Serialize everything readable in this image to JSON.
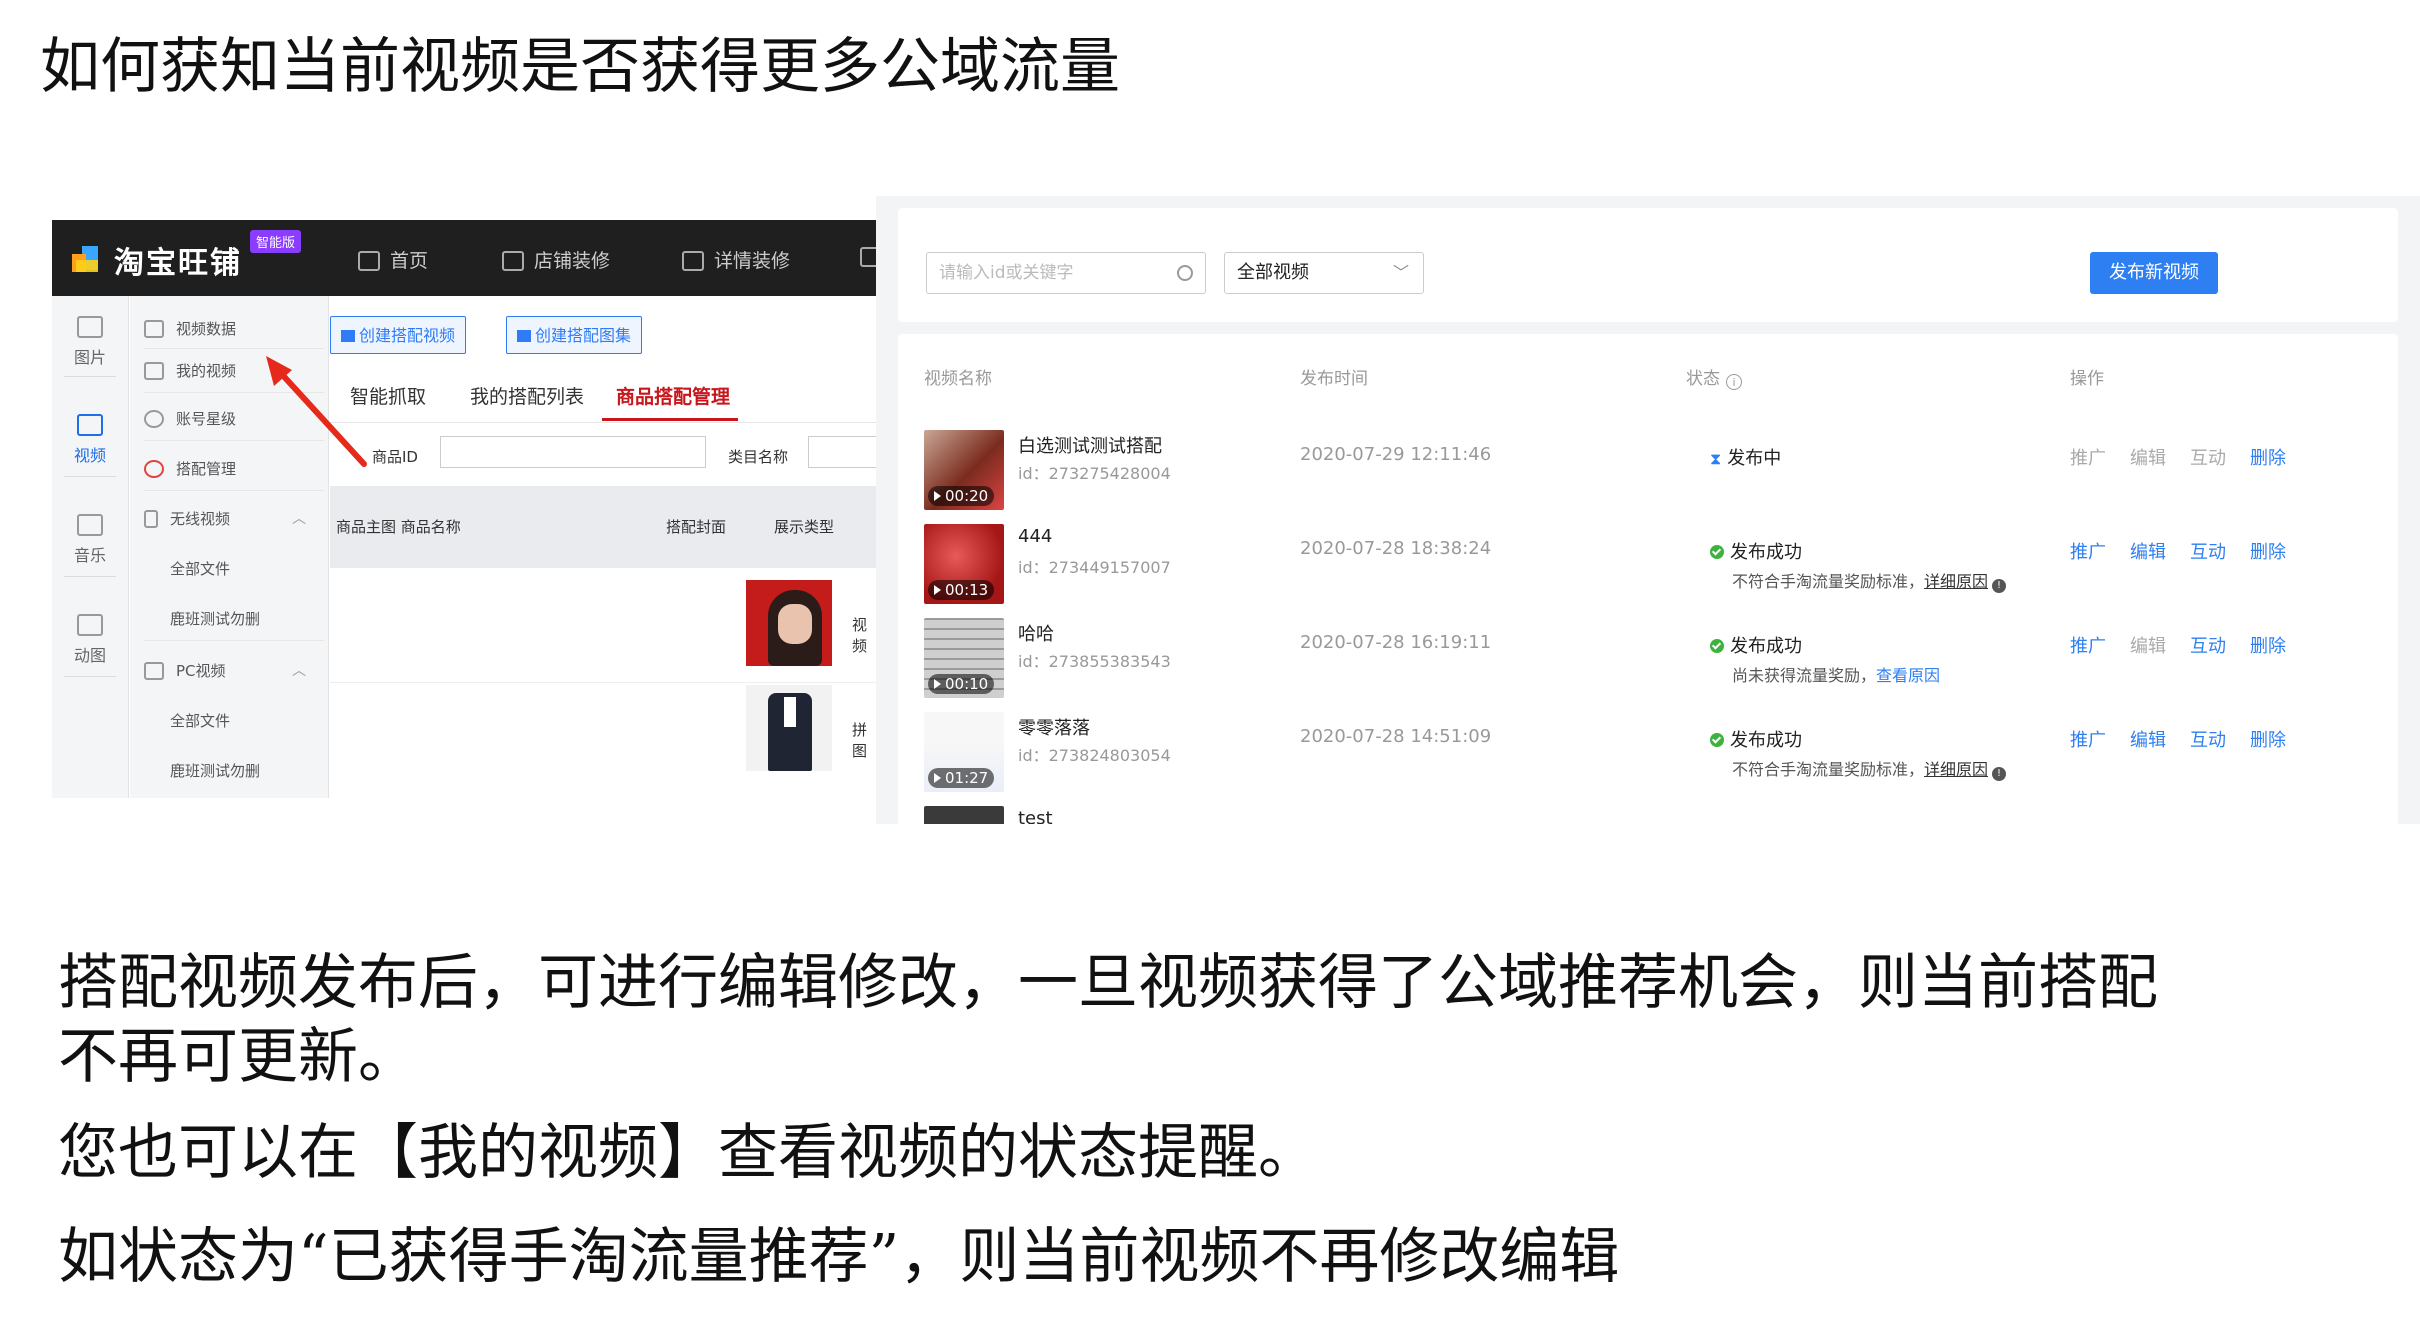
{
  "heading": "如何获知当前视频是否获得更多公域流量",
  "body_lines": [
    "搭配视频发布后，可进行编辑修改，一旦视频获得了公域推荐机会，则当前搭配",
    "不再可更新。",
    "您也可以在【我的视频】查看视频的状态提醒。",
    "如状态为“已获得手淘流量推荐”，则当前视频不再修改编辑"
  ],
  "left_panel": {
    "brand": "淘宝旺铺",
    "edition_badge": "智能版",
    "top_nav": [
      "首页",
      "店铺装修",
      "详情装修"
    ],
    "rail": [
      "图片",
      "视频",
      "音乐",
      "动图"
    ],
    "rail_active": "视频",
    "sidebar": {
      "video_data": "视频数据",
      "my_videos": "我的视频",
      "account_level": "账号星级",
      "match_manage": "搭配管理",
      "wireless_video": "无线视频",
      "wireless_all": "全部文件",
      "wireless_test": "鹿班测试勿删",
      "pc_video": "PC视频",
      "pc_all": "全部文件",
      "pc_test": "鹿班测试勿删"
    },
    "buttons": {
      "create_video": "创建搭配视频",
      "create_album": "创建搭配图集"
    },
    "tabs": [
      "智能抓取",
      "我的搭配列表",
      "商品搭配管理"
    ],
    "active_tab": "商品搭配管理",
    "filters": {
      "product_id": "商品ID",
      "category": "类目名称"
    },
    "table_headers": {
      "main_img_name": "商品主图 商品名称",
      "cover": "搭配封面",
      "type": "展示类型"
    },
    "rows": [
      {
        "type": "视频"
      },
      {
        "type": "拼图"
      }
    ]
  },
  "right_panel": {
    "search_placeholder": "请输入id或关键字",
    "filter_value": "全部视频",
    "publish_button": "发布新视频",
    "headers": {
      "name": "视频名称",
      "time": "发布时间",
      "status": "状态",
      "ops": "操作"
    },
    "ops_labels": [
      "推广",
      "编辑",
      "互动",
      "删除"
    ],
    "videos": [
      {
        "name": "白选测试测试搭配",
        "id": "id：273275428004",
        "duration": "00:20",
        "time": "2020-07-29 12:11:46",
        "status": "发布中",
        "note_text": "",
        "note_link": ""
      },
      {
        "name": "444",
        "id": "id：273449157007",
        "duration": "00:13",
        "time": "2020-07-28 18:38:24",
        "status": "发布成功",
        "note_text": "不符合手淘流量奖励标准，",
        "note_link": "详细原因"
      },
      {
        "name": "哈哈",
        "id": "id：273855383543",
        "duration": "00:10",
        "time": "2020-07-28 16:19:11",
        "status": "发布成功",
        "note_text": "尚未获得流量奖励，",
        "note_link": "查看原因"
      },
      {
        "name": "零零落落",
        "id": "id：273824803054",
        "duration": "01:27",
        "time": "2020-07-28 14:51:09",
        "status": "发布成功",
        "note_text": "不符合手淘流量奖励标准，",
        "note_link": "详细原因"
      },
      {
        "name": "test"
      }
    ]
  },
  "colors": {
    "brand_blue": "#2d7ff2",
    "active_red": "#c8161d",
    "success_green": "#3cb33c",
    "arrow_red": "#e52a1c"
  }
}
